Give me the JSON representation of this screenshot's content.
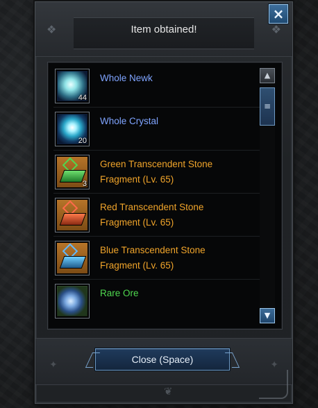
{
  "dialog": {
    "title": "Item obtained!",
    "close_label": "Close (Space)",
    "close_icon": "×"
  },
  "items": [
    {
      "name": "Whole Newk",
      "count": "44",
      "color": "#7fa4ff",
      "icon": "newk-crystal-icon"
    },
    {
      "name": "Whole Crystal",
      "count": "20",
      "color": "#7fa4ff",
      "icon": "whole-crystal-icon"
    },
    {
      "name": "Green Transcendent Stone Fragment (Lv. 65)",
      "line1": "Green Transcendent Stone",
      "line2": "Fragment (Lv. 65)",
      "count": "3",
      "color": "#f0a42a",
      "icon": "green-stone-fragment-icon"
    },
    {
      "name": "Red Transcendent Stone Fragment (Lv. 65)",
      "line1": "Red Transcendent Stone",
      "line2": "Fragment (Lv. 65)",
      "count": "",
      "color": "#f0a42a",
      "icon": "red-stone-fragment-icon"
    },
    {
      "name": "Blue Transcendent Stone Fragment (Lv. 65)",
      "line1": "Blue Transcendent Stone",
      "line2": "Fragment (Lv. 65)",
      "count": "",
      "color": "#f0a42a",
      "icon": "blue-stone-fragment-icon"
    },
    {
      "name": "Rare Ore",
      "count": "",
      "color": "#4fd84f",
      "icon": "rare-ore-icon"
    }
  ],
  "scrollbar": {
    "up": "▲",
    "thumb": "≡",
    "down": "▼"
  },
  "colors": {
    "magic": "#7fa4ff",
    "heroic": "#f0a42a",
    "rare": "#4fd84f",
    "accent": "#3c6c98"
  }
}
